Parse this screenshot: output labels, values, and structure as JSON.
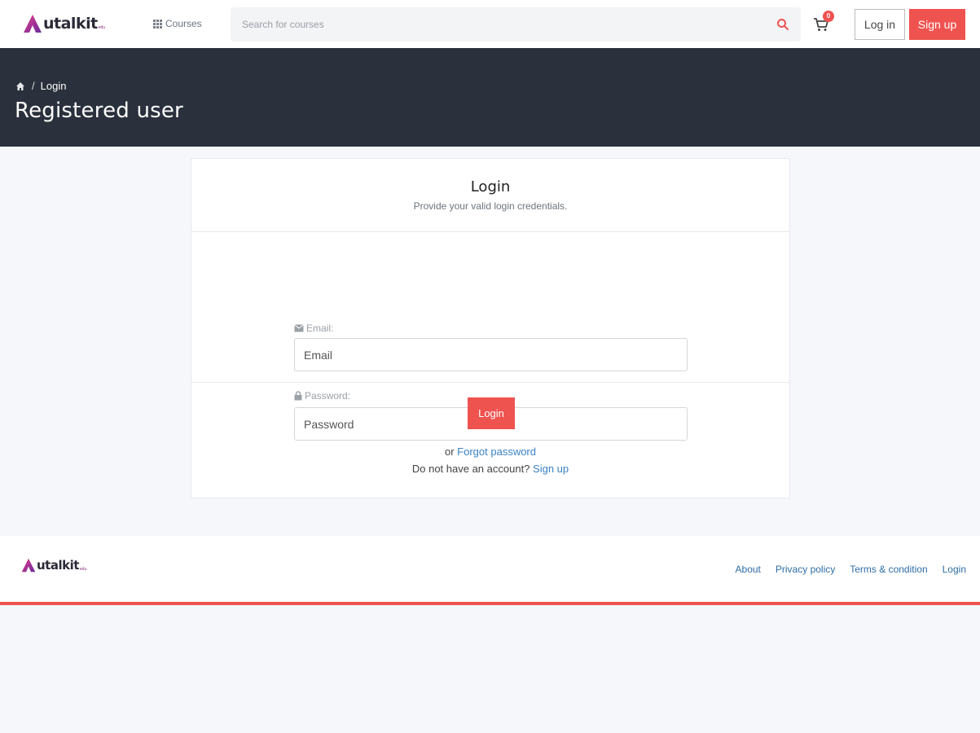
{
  "brand": {
    "name": "utalkit",
    "tagline": "edu",
    "accent": "#ef5350",
    "logo_gradient": [
      "#e63a8a",
      "#6a2b9c"
    ]
  },
  "header": {
    "courses_label": "Courses",
    "search_placeholder": "Search for courses",
    "cart_count": "0",
    "login_label": "Log in",
    "signup_label": "Sign up"
  },
  "banner": {
    "breadcrumb_current": "Login",
    "breadcrumb_sep": "/",
    "title": "Registered user",
    "bg": "#2a303c"
  },
  "login_card": {
    "title": "Login",
    "subtitle": "Provide your valid login credentials.",
    "email_label": "Email:",
    "email_placeholder": "Email",
    "password_label": "Password:",
    "password_placeholder": "Password",
    "submit_label": "Login",
    "or_text": "or",
    "forgot_link": "Forgot password",
    "no_account_text": "Do not have an account?",
    "signup_link": "Sign up"
  },
  "footer": {
    "links": [
      "About",
      "Privacy policy",
      "Terms & condition",
      "Login"
    ]
  }
}
